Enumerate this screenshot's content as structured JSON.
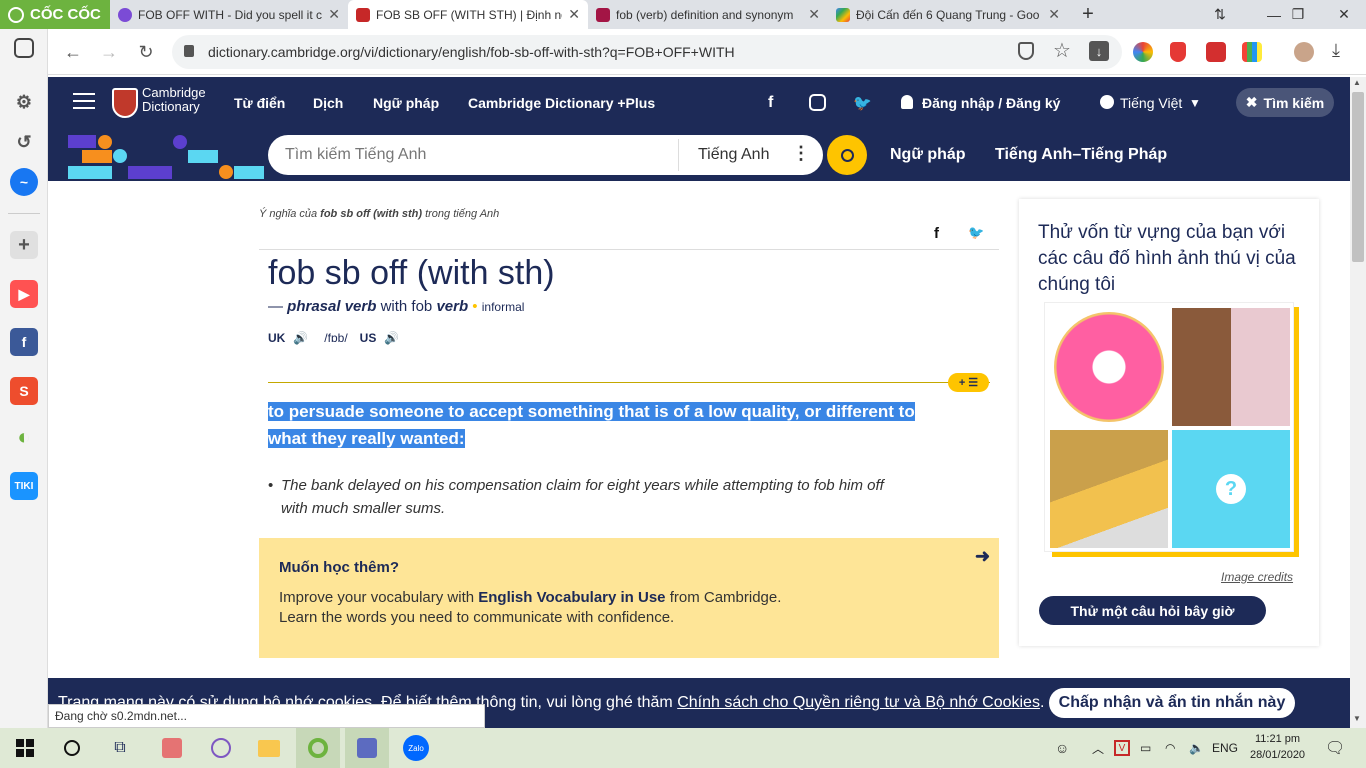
{
  "browser": {
    "brand": "CỐC CỐC",
    "tabs": [
      {
        "title": "FOB OFF WITH - Did you spell it co",
        "color": "#7b4bd6"
      },
      {
        "title": "FOB SB OFF (WITH STH) | Định ngh",
        "color": "#c62828"
      },
      {
        "title": "fob (verb) definition and synonym",
        "color": "#a31545"
      },
      {
        "title": "Đội Cấn đến 6 Quang Trung - Goo",
        "color": "#34a853"
      }
    ],
    "url": "dictionary.cambridge.org/vi/dictionary/english/fob-sb-off-with-sth?q=FOB+OFF+WITH",
    "new_tab": "+",
    "status_text": "Đang chờ s0.2mdn.net..."
  },
  "site": {
    "logo_line1": "Cambridge",
    "logo_line2": "Dictionary",
    "nav": [
      "Từ điển",
      "Dịch",
      "Ngữ pháp",
      "Cambridge Dictionary +Plus"
    ],
    "login": "Đăng nhập / Đăng ký",
    "language": "Tiếng Việt",
    "search_button": "Tìm kiếm",
    "search_placeholder": "Tìm kiếm Tiếng Anh",
    "search_lang": "Tiếng Anh",
    "grammar_link": "Ngữ pháp",
    "french_link": "Tiếng Anh–Tiếng Pháp"
  },
  "entry": {
    "meaning_prefix": "Ý nghĩa của",
    "meaning_word": "fob sb off (with sth)",
    "meaning_suffix": "trong tiếng Anh",
    "headword": "fob sb off (with sth)",
    "dash": "—",
    "pos": "phrasal verb",
    "with_text": "with fob",
    "verb": "verb",
    "dot": "•",
    "register": "informal",
    "uk": "UK",
    "ipa": "/fɒb/",
    "us": "US",
    "definition_line1": "to persuade someone to accept something that is of a low quality, or different to",
    "definition_line2": "what they really wanted:",
    "example_line1": "The bank delayed on his compensation claim for eight years while attempting to fob him off",
    "example_line2": "with much smaller sums.",
    "more_title": "Muốn học thêm?",
    "more_line1_pre": "Improve your vocabulary with ",
    "more_line1_bold": "English Vocabulary in Use",
    "more_line1_post": " from Cambridge.",
    "more_line2": "Learn the words you need to communicate with confidence."
  },
  "quiz": {
    "heading": "Thử vốn từ vựng của bạn với các câu đố hình ảnh thú vị của chúng tôi",
    "image_credits": "Image credits",
    "button": "Thử một câu hỏi bây giờ",
    "question_mark": "?"
  },
  "cookie": {
    "text": "Trang mạng này có sử dụng bộ nhớ cookies. Để biết thêm thông tin, vui lòng ghé thăm ",
    "link": "Chính sách cho Quyền riêng tư và Bộ nhớ Cookies",
    "period": ".",
    "button": "Chấp nhận và ẩn tin nhắn này"
  },
  "taskbar": {
    "lang": "ENG",
    "time": "11:21 pm",
    "date": "28/01/2020",
    "zalo": "Zalo"
  }
}
